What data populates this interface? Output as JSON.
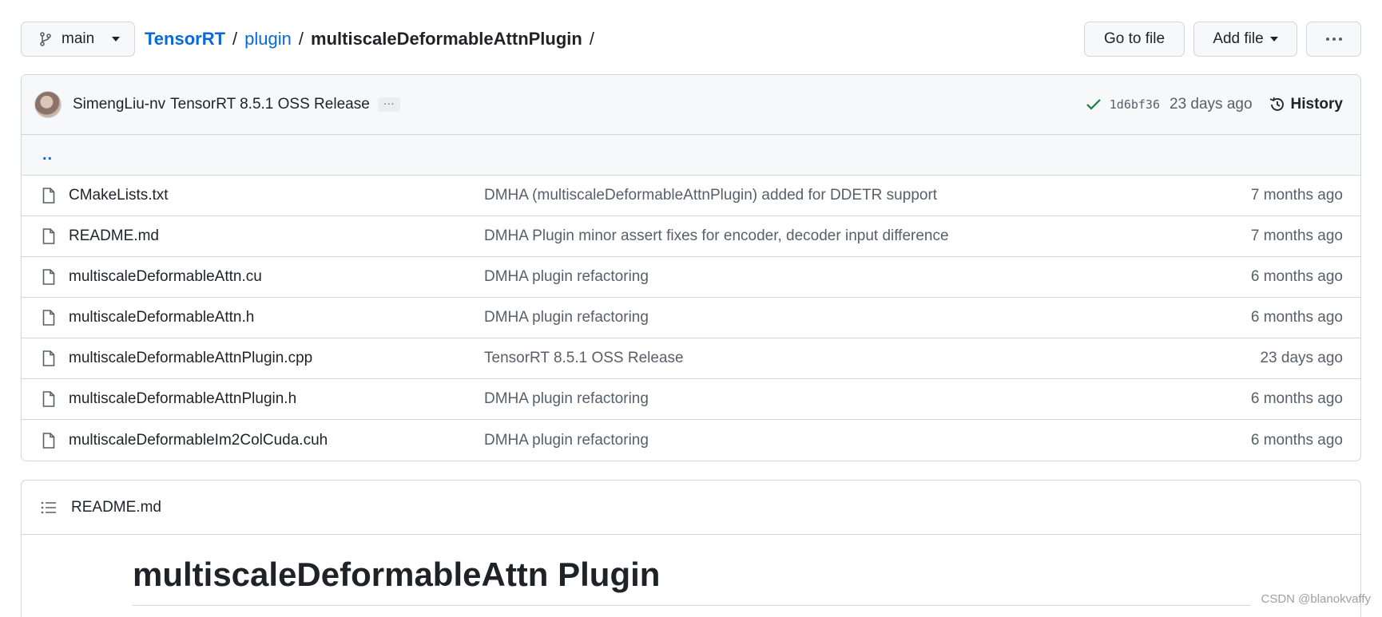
{
  "branch": {
    "name": "main"
  },
  "breadcrumb": {
    "repo": "TensorRT",
    "folder": "plugin",
    "current": "multiscaleDeformableAttnPlugin",
    "sep": "/",
    "trailing": "/"
  },
  "actions": {
    "goto_file": "Go to file",
    "add_file": "Add file",
    "more": "···"
  },
  "commit": {
    "author": "SimengLiu-nv",
    "message": "TensorRT 8.5.1 OSS Release",
    "ellipsis": "···",
    "sha": "1d6bf36",
    "age": "23 days ago",
    "history_label": "History"
  },
  "parent_dir": "..",
  "files": [
    {
      "name": "CMakeLists.txt",
      "message": "DMHA (multiscaleDeformableAttnPlugin) added for DDETR support",
      "age": "7 months ago"
    },
    {
      "name": "README.md",
      "message": "DMHA Plugin minor assert fixes for encoder, decoder input difference",
      "age": "7 months ago"
    },
    {
      "name": "multiscaleDeformableAttn.cu",
      "message": "DMHA plugin refactoring",
      "age": "6 months ago"
    },
    {
      "name": "multiscaleDeformableAttn.h",
      "message": "DMHA plugin refactoring",
      "age": "6 months ago"
    },
    {
      "name": "multiscaleDeformableAttnPlugin.cpp",
      "message": "TensorRT 8.5.1 OSS Release",
      "age": "23 days ago"
    },
    {
      "name": "multiscaleDeformableAttnPlugin.h",
      "message": "DMHA plugin refactoring",
      "age": "6 months ago"
    },
    {
      "name": "multiscaleDeformableIm2ColCuda.cuh",
      "message": "DMHA plugin refactoring",
      "age": "6 months ago"
    }
  ],
  "readme": {
    "filename": "README.md",
    "title": "multiscaleDeformableAttn Plugin"
  },
  "watermark": "CSDN @blanokvaffy",
  "colors": {
    "link": "#0969da",
    "success": "#1a7f37",
    "muted": "#57606a",
    "border": "#d0d7de"
  }
}
